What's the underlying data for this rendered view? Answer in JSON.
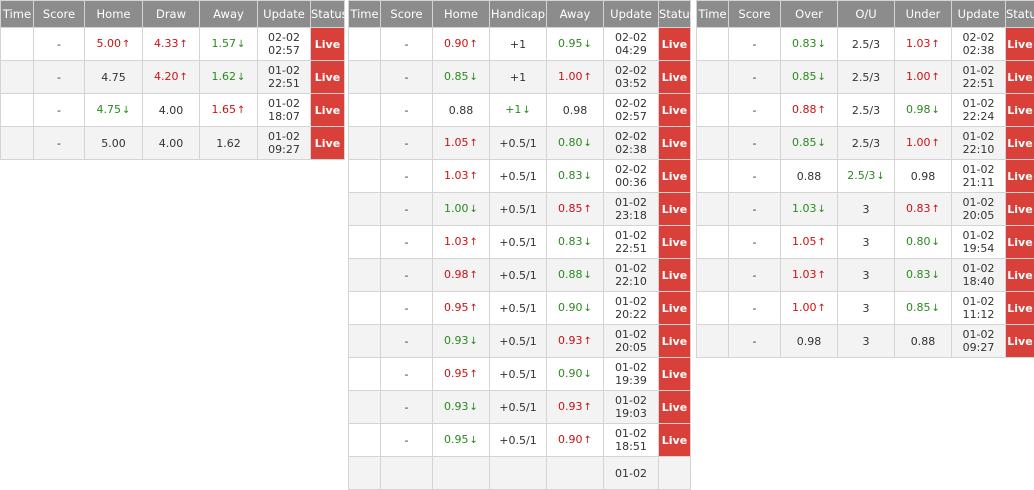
{
  "colors": {
    "header_bg": "#8c8c8c",
    "status_bg": "#d9403a",
    "up": "#cc1111",
    "down": "#2a8a1e",
    "stripe": "#f3f3f3"
  },
  "icons": {
    "up": "arrow-up-icon",
    "down": "arrow-down-icon"
  },
  "tables": [
    {
      "id": "1x2",
      "headers": [
        "Time",
        "Score",
        "Home",
        "Draw",
        "Away",
        "Update",
        "Status"
      ],
      "rows": [
        {
          "time": "",
          "score": "-",
          "a": {
            "v": "5.00",
            "d": "up"
          },
          "b": {
            "v": "4.33",
            "d": "up"
          },
          "c": {
            "v": "1.57",
            "d": "down"
          },
          "update": "02-02\n02:57",
          "status": "Live"
        },
        {
          "time": "",
          "score": "-",
          "a": {
            "v": "4.75",
            "d": ""
          },
          "b": {
            "v": "4.20",
            "d": "up"
          },
          "c": {
            "v": "1.62",
            "d": "down"
          },
          "update": "01-02\n22:51",
          "status": "Live"
        },
        {
          "time": "",
          "score": "-",
          "a": {
            "v": "4.75",
            "d": "down"
          },
          "b": {
            "v": "4.00",
            "d": ""
          },
          "c": {
            "v": "1.65",
            "d": "up"
          },
          "update": "01-02\n18:07",
          "status": "Live"
        },
        {
          "time": "",
          "score": "-",
          "a": {
            "v": "5.00",
            "d": ""
          },
          "b": {
            "v": "4.00",
            "d": ""
          },
          "c": {
            "v": "1.62",
            "d": ""
          },
          "update": "01-02\n09:27",
          "status": "Live"
        }
      ]
    },
    {
      "id": "handicap",
      "headers": [
        "Time",
        "Score",
        "Home",
        "Handicap",
        "Away",
        "Update",
        "Status"
      ],
      "rows": [
        {
          "time": "",
          "score": "-",
          "a": {
            "v": "0.90",
            "d": "up"
          },
          "b": {
            "v": "+1",
            "d": ""
          },
          "c": {
            "v": "0.95",
            "d": "down"
          },
          "update": "02-02\n04:29",
          "status": "Live"
        },
        {
          "time": "",
          "score": "-",
          "a": {
            "v": "0.85",
            "d": "down"
          },
          "b": {
            "v": "+1",
            "d": ""
          },
          "c": {
            "v": "1.00",
            "d": "up"
          },
          "update": "02-02\n03:52",
          "status": "Live"
        },
        {
          "time": "",
          "score": "-",
          "a": {
            "v": "0.88",
            "d": ""
          },
          "b": {
            "v": "+1",
            "d": "down"
          },
          "c": {
            "v": "0.98",
            "d": ""
          },
          "update": "02-02\n02:57",
          "status": "Live"
        },
        {
          "time": "",
          "score": "-",
          "a": {
            "v": "1.05",
            "d": "up"
          },
          "b": {
            "v": "+0.5/1",
            "d": ""
          },
          "c": {
            "v": "0.80",
            "d": "down"
          },
          "update": "02-02\n02:38",
          "status": "Live"
        },
        {
          "time": "",
          "score": "-",
          "a": {
            "v": "1.03",
            "d": "up"
          },
          "b": {
            "v": "+0.5/1",
            "d": ""
          },
          "c": {
            "v": "0.83",
            "d": "down"
          },
          "update": "02-02\n00:36",
          "status": "Live"
        },
        {
          "time": "",
          "score": "-",
          "a": {
            "v": "1.00",
            "d": "down"
          },
          "b": {
            "v": "+0.5/1",
            "d": ""
          },
          "c": {
            "v": "0.85",
            "d": "up"
          },
          "update": "01-02\n23:18",
          "status": "Live"
        },
        {
          "time": "",
          "score": "-",
          "a": {
            "v": "1.03",
            "d": "up"
          },
          "b": {
            "v": "+0.5/1",
            "d": ""
          },
          "c": {
            "v": "0.83",
            "d": "down"
          },
          "update": "01-02\n22:51",
          "status": "Live"
        },
        {
          "time": "",
          "score": "-",
          "a": {
            "v": "0.98",
            "d": "up"
          },
          "b": {
            "v": "+0.5/1",
            "d": ""
          },
          "c": {
            "v": "0.88",
            "d": "down"
          },
          "update": "01-02\n22:10",
          "status": "Live"
        },
        {
          "time": "",
          "score": "-",
          "a": {
            "v": "0.95",
            "d": "up"
          },
          "b": {
            "v": "+0.5/1",
            "d": ""
          },
          "c": {
            "v": "0.90",
            "d": "down"
          },
          "update": "01-02\n20:22",
          "status": "Live"
        },
        {
          "time": "",
          "score": "-",
          "a": {
            "v": "0.93",
            "d": "down"
          },
          "b": {
            "v": "+0.5/1",
            "d": ""
          },
          "c": {
            "v": "0.93",
            "d": "up"
          },
          "update": "01-02\n20:05",
          "status": "Live"
        },
        {
          "time": "",
          "score": "-",
          "a": {
            "v": "0.95",
            "d": "up"
          },
          "b": {
            "v": "+0.5/1",
            "d": ""
          },
          "c": {
            "v": "0.90",
            "d": "down"
          },
          "update": "01-02\n19:39",
          "status": "Live"
        },
        {
          "time": "",
          "score": "-",
          "a": {
            "v": "0.93",
            "d": "down"
          },
          "b": {
            "v": "+0.5/1",
            "d": ""
          },
          "c": {
            "v": "0.93",
            "d": "up"
          },
          "update": "01-02\n19:03",
          "status": "Live"
        },
        {
          "time": "",
          "score": "-",
          "a": {
            "v": "0.95",
            "d": "down"
          },
          "b": {
            "v": "+0.5/1",
            "d": ""
          },
          "c": {
            "v": "0.90",
            "d": "up"
          },
          "update": "01-02\n18:51",
          "status": "Live"
        },
        {
          "time": "",
          "score": "",
          "a": {
            "v": "",
            "d": ""
          },
          "b": {
            "v": "",
            "d": ""
          },
          "c": {
            "v": "",
            "d": ""
          },
          "update": "01-02",
          "status": ""
        }
      ]
    },
    {
      "id": "over-under",
      "headers": [
        "Time",
        "Score",
        "Over",
        "O/U",
        "Under",
        "Update",
        "Status"
      ],
      "rows": [
        {
          "time": "",
          "score": "-",
          "a": {
            "v": "0.83",
            "d": "down"
          },
          "b": {
            "v": "2.5/3",
            "d": ""
          },
          "c": {
            "v": "1.03",
            "d": "up"
          },
          "update": "02-02\n02:38",
          "status": "Live"
        },
        {
          "time": "",
          "score": "-",
          "a": {
            "v": "0.85",
            "d": "down"
          },
          "b": {
            "v": "2.5/3",
            "d": ""
          },
          "c": {
            "v": "1.00",
            "d": "up"
          },
          "update": "01-02\n22:51",
          "status": "Live"
        },
        {
          "time": "",
          "score": "-",
          "a": {
            "v": "0.88",
            "d": "up"
          },
          "b": {
            "v": "2.5/3",
            "d": ""
          },
          "c": {
            "v": "0.98",
            "d": "down"
          },
          "update": "01-02\n22:24",
          "status": "Live"
        },
        {
          "time": "",
          "score": "-",
          "a": {
            "v": "0.85",
            "d": "down"
          },
          "b": {
            "v": "2.5/3",
            "d": ""
          },
          "c": {
            "v": "1.00",
            "d": "up"
          },
          "update": "01-02\n22:10",
          "status": "Live"
        },
        {
          "time": "",
          "score": "-",
          "a": {
            "v": "0.88",
            "d": ""
          },
          "b": {
            "v": "2.5/3",
            "d": "down"
          },
          "c": {
            "v": "0.98",
            "d": ""
          },
          "update": "01-02\n21:11",
          "status": "Live"
        },
        {
          "time": "",
          "score": "-",
          "a": {
            "v": "1.03",
            "d": "down"
          },
          "b": {
            "v": "3",
            "d": ""
          },
          "c": {
            "v": "0.83",
            "d": "up"
          },
          "update": "01-02\n20:05",
          "status": "Live"
        },
        {
          "time": "",
          "score": "-",
          "a": {
            "v": "1.05",
            "d": "up"
          },
          "b": {
            "v": "3",
            "d": ""
          },
          "c": {
            "v": "0.80",
            "d": "down"
          },
          "update": "01-02\n19:54",
          "status": "Live"
        },
        {
          "time": "",
          "score": "-",
          "a": {
            "v": "1.03",
            "d": "up"
          },
          "b": {
            "v": "3",
            "d": ""
          },
          "c": {
            "v": "0.83",
            "d": "down"
          },
          "update": "01-02\n18:40",
          "status": "Live"
        },
        {
          "time": "",
          "score": "-",
          "a": {
            "v": "1.00",
            "d": "up"
          },
          "b": {
            "v": "3",
            "d": ""
          },
          "c": {
            "v": "0.85",
            "d": "down"
          },
          "update": "01-02\n11:12",
          "status": "Live"
        },
        {
          "time": "",
          "score": "-",
          "a": {
            "v": "0.98",
            "d": ""
          },
          "b": {
            "v": "3",
            "d": ""
          },
          "c": {
            "v": "0.88",
            "d": ""
          },
          "update": "01-02\n09:27",
          "status": "Live"
        }
      ]
    }
  ]
}
